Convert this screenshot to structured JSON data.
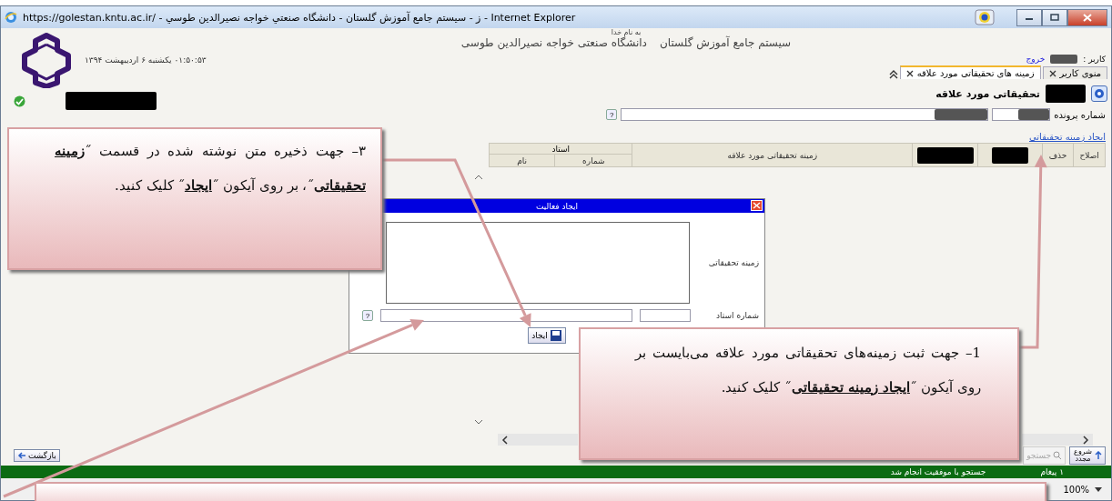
{
  "window": {
    "title": "https://golestan.kntu.ac.ir/ - ز - سيستم جامع آموزش گلستان - دانشگاه صنعتي خواجه نصيرالدين طوسي - Internet Explorer"
  },
  "header": {
    "bismillah": "به نام خدا",
    "system_name": "سیستم جامع آموزش گلستان",
    "university": "دانشگاه صنعتی خواجه نصیرالدین طوسی",
    "datetime": "۰۱:۵۰:۵۳ یکشنبه ۶ اردیبهشت ۱۳۹۴",
    "user_label": "کاربر :",
    "logout": "خروج"
  },
  "tabs": [
    {
      "label": "منوی کاربر",
      "selected": false
    },
    {
      "label": "زمینه های تحقیقاتی مورد علاقه",
      "selected": true
    }
  ],
  "page": {
    "title": "تحقیقاتی مورد علاقه",
    "file_number_label": "شماره پرونده",
    "help_button": "?",
    "create_link": "ایجاد زمینه تحقیقاتی"
  },
  "table": {
    "columns": [
      "اصلاح",
      "حذف",
      "زمینه تحقیقاتی مورد علاقه"
    ],
    "group": "استاد",
    "sub_columns": [
      "شماره",
      "نام"
    ]
  },
  "dialog": {
    "title": "ایجاد فعالیت",
    "topic_label": "زمینه تحقیقاتی",
    "professor_label": "شماره استاد",
    "help_button": "?",
    "create_button": "ایجاد"
  },
  "footer": {
    "back": "بازگشت",
    "search": "جستجو",
    "search_disabled": true,
    "restart": "شروع مجدد"
  },
  "status": {
    "count": "۱ پیغام",
    "message": "جستجو با موفقیت انجام شد"
  },
  "zoom": "100%",
  "callouts": [
    {
      "text": "۳– جهت ذخیره متن نوشته شده در قسمت ˝**زمینه تحقیقاتی**˝، بر روی آیکون ˝**ایجاد**˝ کلیک کنید."
    },
    {
      "text": "1– جهت ثبت زمینه‌های تحقیقاتی مورد علاقه می‌بایست بر روی آیکون ˝**ایجاد زمینه تحقیقاتی**˝ کلیک کنید."
    }
  ]
}
